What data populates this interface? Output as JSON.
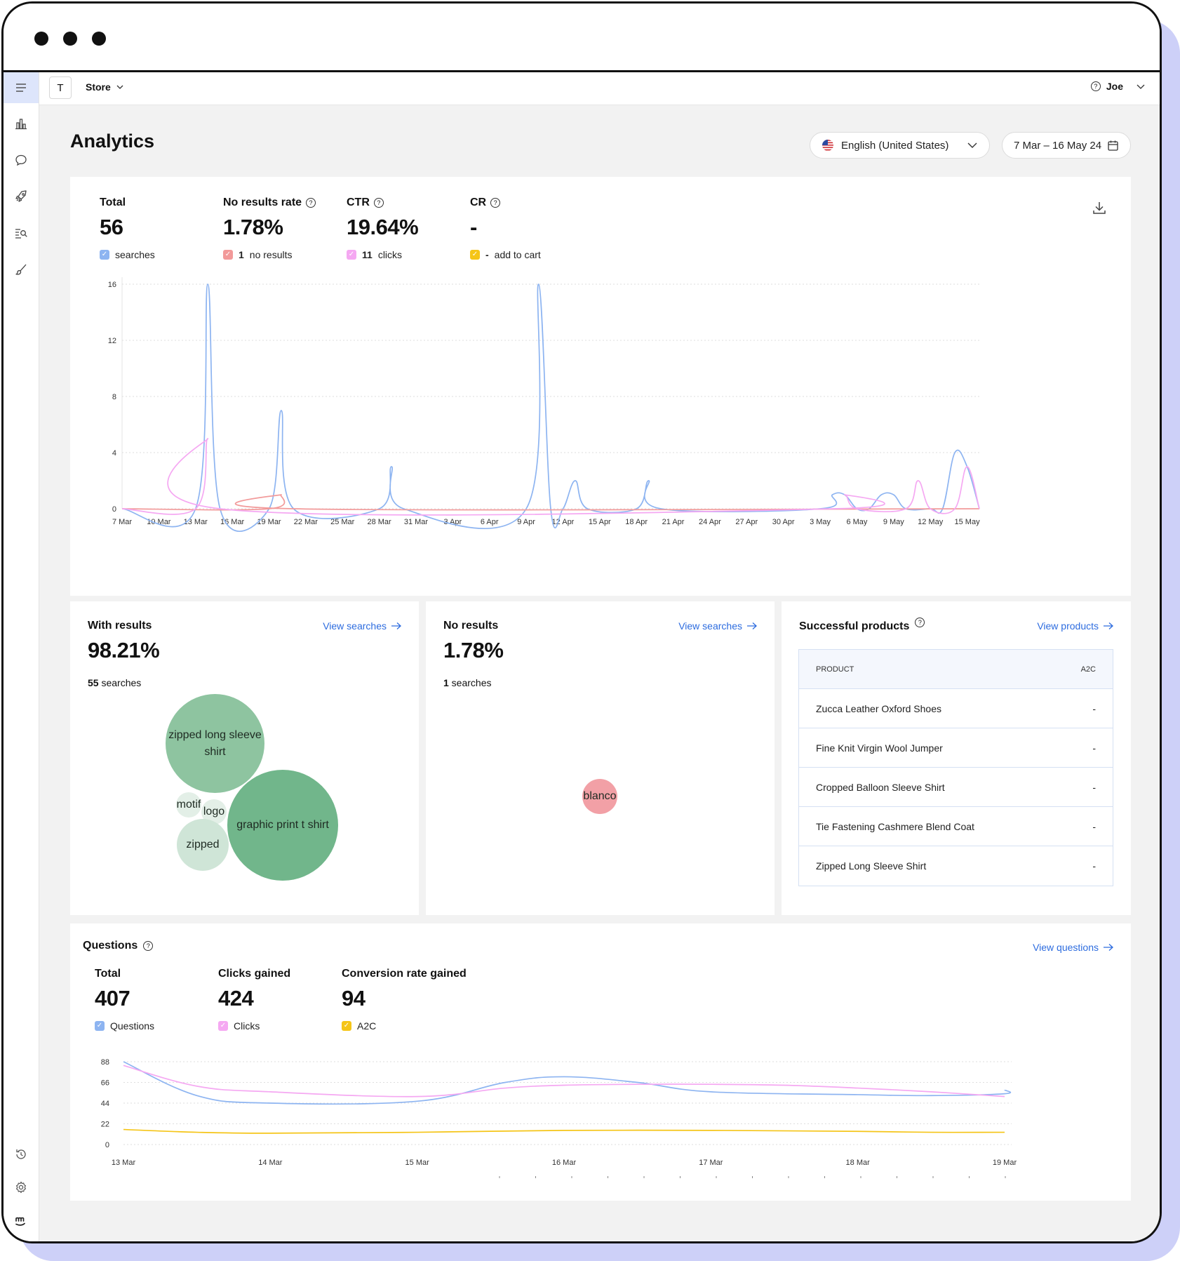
{
  "header": {
    "store_badge": "T",
    "store_name": "Store",
    "user_name": "Joe"
  },
  "page": {
    "title": "Analytics",
    "language": "English (United States)",
    "date_range": "7 Mar – 16 May 24"
  },
  "overview": {
    "metrics": [
      {
        "label": "Total",
        "value": "56",
        "legend_count": "",
        "legend_text": "searches",
        "color": "#8db4f1"
      },
      {
        "label": "No results rate",
        "value": "1.78%",
        "legend_count": "1",
        "legend_text": "no results",
        "color": "#f29a9a"
      },
      {
        "label": "CTR",
        "value": "19.64%",
        "legend_count": "11",
        "legend_text": "clicks",
        "color": "#f5a8f2"
      },
      {
        "label": "CR",
        "value": "-",
        "legend_count": "-",
        "legend_text": "add to cart",
        "color": "#f5c518"
      }
    ]
  },
  "with_results": {
    "title": "With results",
    "link": "View searches",
    "value": "98.21%",
    "count": "55",
    "count_label": " searches",
    "bubbles": [
      "zipped long sleeve shirt",
      "motif",
      "logo",
      "graphic print t shirt",
      "zipped"
    ]
  },
  "no_results": {
    "title": "No results",
    "link": "View searches",
    "value": "1.78%",
    "count": "1",
    "count_label": " searches",
    "bubbles": [
      "blanco"
    ]
  },
  "products": {
    "title": "Successful products",
    "link": "View products",
    "col_product": "PRODUCT",
    "col_a2c": "A2C",
    "rows": [
      {
        "name": "Zucca Leather Oxford Shoes",
        "a2c": "-"
      },
      {
        "name": "Fine Knit Virgin Wool Jumper",
        "a2c": "-"
      },
      {
        "name": "Cropped Balloon Sleeve Shirt",
        "a2c": "-"
      },
      {
        "name": "Tie Fastening Cashmere Blend Coat",
        "a2c": "-"
      },
      {
        "name": "Zipped Long Sleeve Shirt",
        "a2c": "-"
      }
    ]
  },
  "questions": {
    "title": "Questions",
    "link": "View questions",
    "metrics": [
      {
        "label": "Total",
        "value": "407",
        "legend": "Questions",
        "color": "#8db4f1"
      },
      {
        "label": "Clicks gained",
        "value": "424",
        "legend": "Clicks",
        "color": "#f5a8f2"
      },
      {
        "label": "Conversion rate gained",
        "value": "94",
        "legend": "A2C",
        "color": "#f5c518"
      }
    ]
  },
  "chart_data": [
    {
      "type": "line",
      "x": [
        "7 Mar",
        "10 Mar",
        "13 Mar",
        "16 Mar",
        "19 Mar",
        "22 Mar",
        "25 Mar",
        "28 Mar",
        "31 Mar",
        "3 Apr",
        "6 Apr",
        "9 Apr",
        "12 Apr",
        "15 Apr",
        "18 Apr",
        "21 Apr",
        "24 Apr",
        "27 Apr",
        "30 Apr",
        "3 May",
        "6 May",
        "9 May",
        "12 May",
        "15 May"
      ],
      "ylim": [
        0,
        16
      ],
      "yticks": [
        0,
        4,
        8,
        12,
        16
      ],
      "grid": true,
      "series": [
        {
          "name": "searches",
          "color": "#8db4f1",
          "points": [
            [
              7.0,
              0
            ],
            [
              13.0,
              0
            ],
            [
              14.0,
              16
            ],
            [
              15.0,
              0
            ],
            [
              19.0,
              0
            ],
            [
              20.0,
              7
            ],
            [
              21.0,
              0
            ],
            [
              28.0,
              0
            ],
            [
              29.0,
              3
            ],
            [
              30.0,
              0
            ],
            [
              40.0,
              0
            ],
            [
              41.0,
              16
            ],
            [
              42.0,
              0
            ],
            [
              43.0,
              0
            ],
            [
              44.0,
              2
            ],
            [
              45.0,
              0
            ],
            [
              49.0,
              0
            ],
            [
              50.0,
              2
            ],
            [
              51.0,
              0
            ],
            [
              64.0,
              0
            ],
            [
              65.0,
              1
            ],
            [
              66.0,
              1
            ],
            [
              67.0,
              0
            ],
            [
              68.0,
              0
            ],
            [
              69.0,
              1
            ],
            [
              70.0,
              1
            ],
            [
              71.0,
              0
            ],
            [
              73.0,
              0
            ],
            [
              74.0,
              0
            ],
            [
              75.0,
              4
            ],
            [
              76.0,
              3
            ],
            [
              77.0,
              0
            ]
          ]
        },
        {
          "name": "no results",
          "color": "#f29a9a",
          "points": [
            [
              7.0,
              0
            ],
            [
              19.0,
              0
            ],
            [
              20.0,
              1
            ],
            [
              21.0,
              0
            ],
            [
              77.0,
              0
            ]
          ]
        },
        {
          "name": "clicks",
          "color": "#f5a8f2",
          "points": [
            [
              7.0,
              0
            ],
            [
              13.0,
              0
            ],
            [
              14.0,
              5
            ],
            [
              15.0,
              0
            ],
            [
              65.0,
              0
            ],
            [
              66.0,
              1
            ],
            [
              67.0,
              0
            ],
            [
              71.0,
              0
            ],
            [
              72.0,
              2
            ],
            [
              73.0,
              0
            ],
            [
              75.0,
              0
            ],
            [
              76.0,
              3
            ],
            [
              77.0,
              0
            ]
          ]
        }
      ]
    },
    {
      "type": "line",
      "x": [
        "13 Mar",
        "14 Mar",
        "15 Mar",
        "16 Mar",
        "17 Mar",
        "18 Mar",
        "19 Mar"
      ],
      "ylim": [
        0,
        88
      ],
      "yticks": [
        0,
        22,
        44,
        66,
        88
      ],
      "grid": true,
      "series": [
        {
          "name": "Questions",
          "color": "#8db4f1",
          "points": [
            [
              0,
              88
            ],
            [
              0.5,
              52
            ],
            [
              1,
              44
            ],
            [
              2,
              46
            ],
            [
              2.6,
              66
            ],
            [
              3,
              72
            ],
            [
              3.5,
              66
            ],
            [
              4,
              56
            ],
            [
              5,
              53
            ],
            [
              5.5,
              52
            ],
            [
              6,
              54
            ],
            [
              6,
              58
            ]
          ]
        },
        {
          "name": "Clicks",
          "color": "#f5a8f2",
          "points": [
            [
              0,
              84
            ],
            [
              0.5,
              62
            ],
            [
              1,
              56
            ],
            [
              2,
              51
            ],
            [
              2.6,
              60
            ],
            [
              3,
              63
            ],
            [
              3.5,
              64
            ],
            [
              4,
              64
            ],
            [
              4.5,
              63
            ],
            [
              5,
              60
            ],
            [
              5.5,
              56
            ],
            [
              6,
              51
            ]
          ]
        },
        {
          "name": "A2C",
          "color": "#f5c518",
          "points": [
            [
              0,
              16
            ],
            [
              0.5,
              13
            ],
            [
              1,
              12
            ],
            [
              2,
              13
            ],
            [
              3,
              15
            ],
            [
              4,
              15
            ],
            [
              5,
              14
            ],
            [
              5.5,
              13
            ],
            [
              6,
              13
            ]
          ]
        }
      ]
    }
  ]
}
